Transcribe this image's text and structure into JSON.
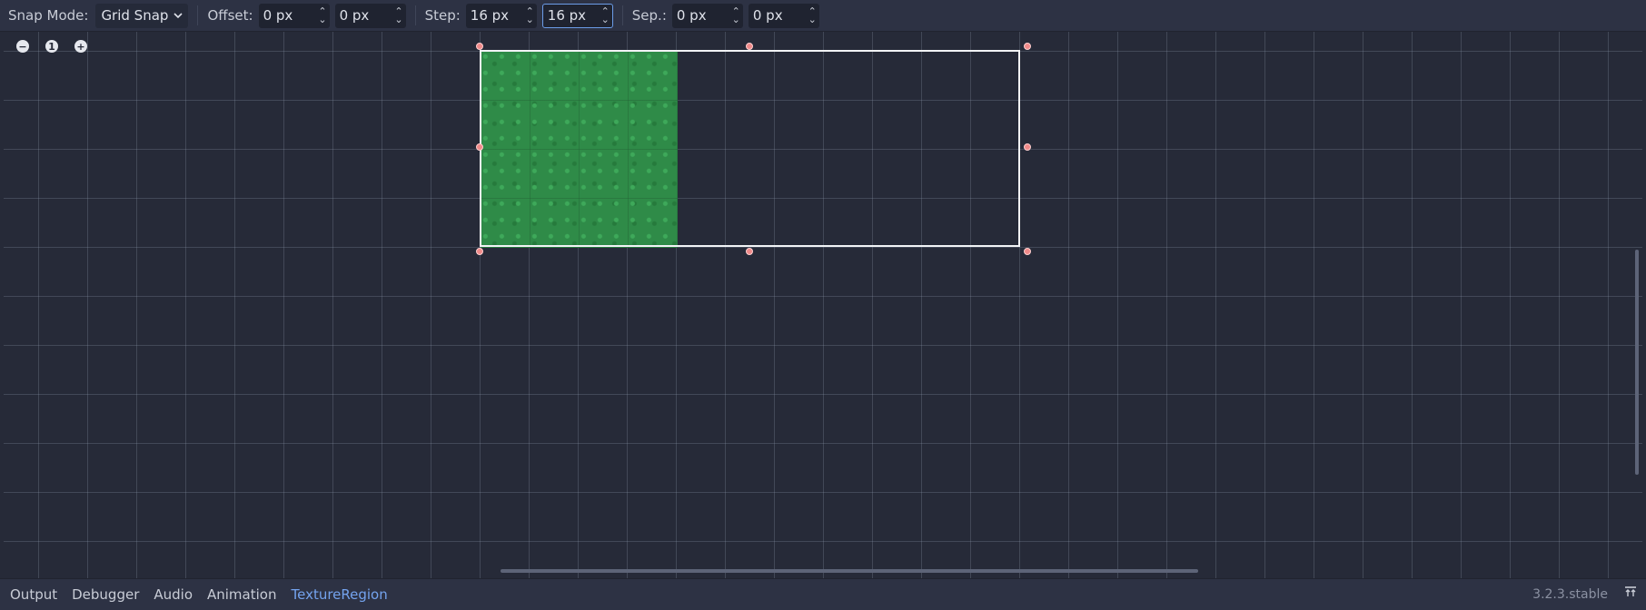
{
  "toolbar": {
    "snap_mode_label": "Snap Mode:",
    "snap_mode_value": "Grid Snap",
    "offset_label": "Offset:",
    "offset_x": "0 px",
    "offset_y": "0 px",
    "step_label": "Step:",
    "step_x": "16 px",
    "step_y": "16 px",
    "sep_label": "Sep.:",
    "sep_x": "0 px",
    "sep_y": "0 px"
  },
  "zoom": {
    "out": "−",
    "reset": "1",
    "in": "+"
  },
  "bottom_tabs": [
    "Output",
    "Debugger",
    "Audio",
    "Animation",
    "TextureRegion"
  ],
  "active_tab": "TextureRegion",
  "version": "3.2.3.stable",
  "icons": {
    "dropdown": "chevron-down-icon",
    "spinner": "spinner-arrows-icon",
    "zoom_out": "zoom-out-icon",
    "zoom_reset": "zoom-reset-icon",
    "zoom_in": "zoom-in-icon",
    "pin": "pin-panel-icon"
  },
  "colors": {
    "background": "#262a38",
    "panel": "#2d3244",
    "accent": "#74a3ee",
    "handle": "#f08a8a",
    "texture": "#2f8b48"
  }
}
